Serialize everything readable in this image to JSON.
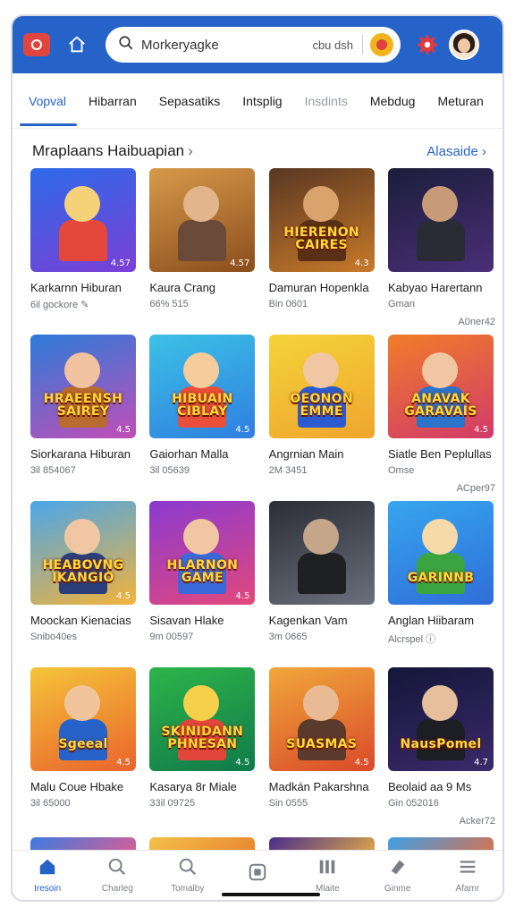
{
  "colors": {
    "accent": "#2563c9",
    "header_bg": "#2563c9"
  },
  "header": {
    "logo_icon": "app-logo-icon",
    "home_icon": "home-icon",
    "search": {
      "icon": "search-icon",
      "query": "Morkeryagke",
      "hint": "cbu dsh"
    },
    "mic_icon": "mic-icon",
    "settings_icon": "gear-icon",
    "avatar_icon": "user-avatar"
  },
  "tabs": [
    {
      "label": "Vopval",
      "active": true
    },
    {
      "label": "Hibarran"
    },
    {
      "label": "Sepasatiks"
    },
    {
      "label": "Intsplig"
    },
    {
      "label": "Insdints",
      "muted": true
    },
    {
      "label": "Mebdug"
    },
    {
      "label": "Meturan"
    }
  ],
  "section": {
    "title": "Mraplaans Haibuapian",
    "more": "Alasaide"
  },
  "rows": [
    {
      "ad_label": "A0ner42",
      "items": [
        {
          "title": "Karkarnn Hiburan",
          "meta": "6il gockore ✎",
          "rating": "4.57",
          "banner": ""
        },
        {
          "title": "Kaura Crang",
          "meta": "66% 515",
          "rating": "4.57",
          "banner": ""
        },
        {
          "title": "Damuran Hopenkla",
          "meta": "Bin 0601",
          "rating": "4.3",
          "banner": "HIERENON CAIRES"
        },
        {
          "title": "Kabyao Harertann",
          "meta": "Gman",
          "rating": "",
          "banner": ""
        }
      ]
    },
    {
      "ad_label": "ACper97",
      "items": [
        {
          "title": "Siorkarana Hiburan",
          "meta": "3il 854067",
          "rating": "4.5",
          "banner": "HRAEENSH SAIREY"
        },
        {
          "title": "Gaiorhan Malla",
          "meta": "3il 05639",
          "rating": "4.5",
          "banner": "HIBUAIN CIBLAY"
        },
        {
          "title": "Angrnian Main",
          "meta": "2M 3451",
          "rating": "",
          "banner": "OEONON EMME"
        },
        {
          "title": "Siatle Ben Peplullas",
          "meta": "Omse",
          "rating": "4.5",
          "banner": "ANAVAK GARAVAIS"
        }
      ]
    },
    {
      "ad_label": "",
      "items": [
        {
          "title": "Moockan Kienacias",
          "meta": "Snibo40es",
          "rating": "4.5",
          "banner": "HEABOVNG IKANGIO"
        },
        {
          "title": "Sisavan Hlake",
          "meta": "9m 00597",
          "rating": "4.5",
          "banner": "HLARNON GAME"
        },
        {
          "title": "Kagenkan Vam",
          "meta": "3m 0665",
          "rating": "",
          "banner": ""
        },
        {
          "title": "Anglan Hiibaram",
          "meta": "Alcrspel ⓘ",
          "rating": "",
          "banner": "GARINNB"
        }
      ]
    },
    {
      "ad_label": "Acker72",
      "items": [
        {
          "title": "Malu Coue Hbake",
          "meta": "3il 65000",
          "rating": "4.5",
          "banner": "Sgeeal"
        },
        {
          "title": "Kasarya 8r Miale",
          "meta": "33il 09725",
          "rating": "4.5",
          "banner": "SKINIDANN PHNESAN"
        },
        {
          "title": "Madkán Pakarshna",
          "meta": "Sin 0555",
          "rating": "4.5",
          "banner": "SUASMAS"
        },
        {
          "title": "Beolaid aa 9 Ms",
          "meta": "Gin 052016",
          "rating": "4.7",
          "banner": "NausPomel"
        }
      ]
    }
  ],
  "bottom_nav": [
    {
      "label": "Iresoin",
      "icon": "home-icon",
      "active": true
    },
    {
      "label": "Charleg",
      "icon": "search-icon"
    },
    {
      "label": "Tomalby",
      "icon": "search-icon"
    },
    {
      "label": "",
      "icon": "square-icon"
    },
    {
      "label": "Mlaite",
      "icon": "library-icon"
    },
    {
      "label": "Ginme",
      "icon": "eraser-icon"
    },
    {
      "label": "Afamr",
      "icon": "menu-icon"
    }
  ]
}
